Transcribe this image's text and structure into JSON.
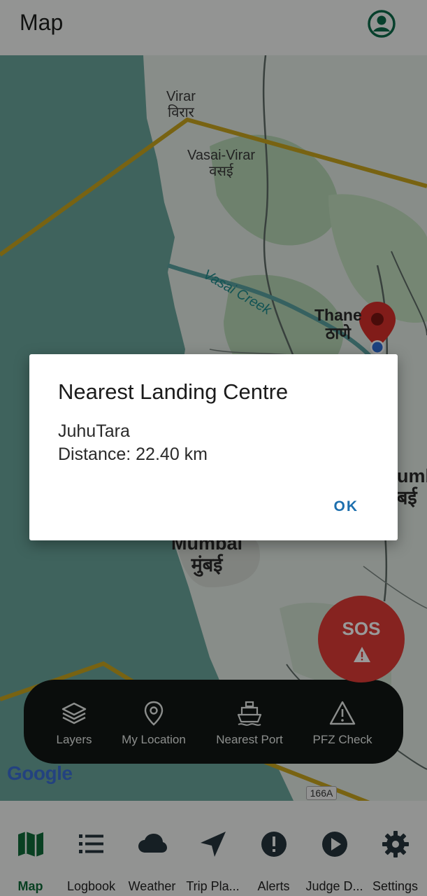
{
  "appbar": {
    "title": "Map",
    "profile_icon": "account-circle-icon"
  },
  "map": {
    "labels": {
      "virar_en": "Virar",
      "virar_hi": "विरार",
      "vasai_en": "Vasai-Virar",
      "vasai_hi": "वसई",
      "creek": "Vasai Creek",
      "thane_en": "Thane",
      "thane_hi": "ठाणे",
      "mumbai_en": "Mumbai",
      "mumbai_hi": "मुंबई",
      "mumbai_east_en": "umb",
      "mumbai_east_hi": "बई"
    },
    "attribution": "Google",
    "road_badge": "166A",
    "marker_color": "#d8302b",
    "location_dot_color": "#2f6fd6",
    "boundary_color": "#d4b21e"
  },
  "toolbar": {
    "items": [
      {
        "label": "Layers",
        "icon": "layers-icon"
      },
      {
        "label": "My Location",
        "icon": "location-pin-icon"
      },
      {
        "label": "Nearest Port",
        "icon": "ship-icon"
      },
      {
        "label": "PFZ Check",
        "icon": "warning-icon"
      }
    ]
  },
  "sos": {
    "label": "SOS",
    "icon": "warning-icon",
    "color": "#e03b36"
  },
  "bottom_nav": {
    "items": [
      {
        "label": "Map",
        "icon": "map-icon",
        "active": true
      },
      {
        "label": "Logbook",
        "icon": "list-icon"
      },
      {
        "label": "Weather",
        "icon": "cloud-icon"
      },
      {
        "label": "Trip Pla...",
        "icon": "navigation-arrow-icon"
      },
      {
        "label": "Alerts",
        "icon": "alert-circle-icon"
      },
      {
        "label": "Judge D...",
        "icon": "play-circle-icon"
      },
      {
        "label": "Settings",
        "icon": "gear-icon"
      }
    ],
    "active_color": "#0f6b3a"
  },
  "dialog": {
    "title": "Nearest Landing Centre",
    "centre_name": "JuhuTara",
    "distance": "Distance: 22.40 km",
    "ok_label": "OK"
  }
}
